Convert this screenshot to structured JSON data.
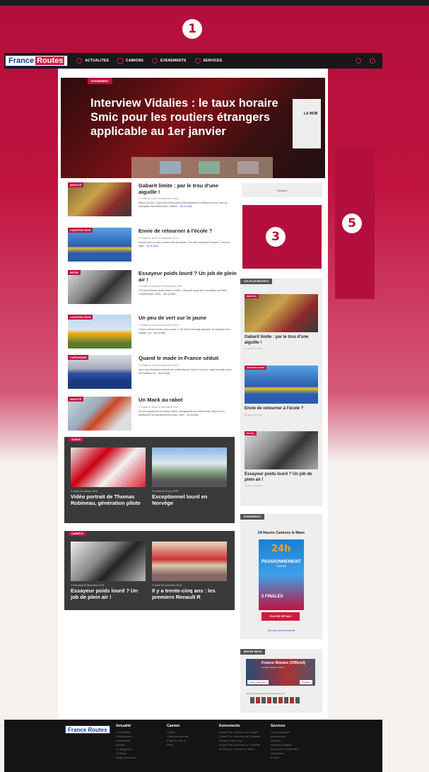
{
  "markers": {
    "m1": "1",
    "m3": "3",
    "m5": "5"
  },
  "nav": {
    "logo_a": "France",
    "logo_b": "Routes",
    "items": [
      "ACTUALITES",
      "CAMIONS",
      "EVENEMENTS",
      "SERVICES"
    ]
  },
  "hero": {
    "tag": "EVENEMENT",
    "title": "Interview Vidalies : le taux horaire Smic pour les routiers étrangers applicable au 1er janvier",
    "side_text": "LA MOB"
  },
  "articles": [
    {
      "tag": "INSOLITE",
      "title": "Gabarit limite : par le trou d'une aiguille !",
      "date": "© Publié le Lundi 14 décembre 2015",
      "excerpt": "Mieux (ou pire ?) que les convois péruviens présentés en début de mois, voici un incroyable franchissement. L'affaire...",
      "more": "lire la suite"
    },
    {
      "tag": "CONSTRUCTEUR",
      "title": "Envie de retourner à l'école ?",
      "date": "© Publié le Jeudi 10 décembre 2015",
      "excerpt": "Avouez qu'il y a pire comme salle de classe. Ces deux superbes Renault T, dont un High...",
      "more": "lire la suite"
    },
    {
      "tag": "RETRO",
      "title": "Essayeur poids lourd ? Un job de plein air !",
      "date": "© Publié le Mercredi 09 décembre 2015",
      "excerpt": "Si France Routes avait existé en 1935, voilà quel aurait été le quotidien de Poids Commerciale. Enfin,...",
      "more": "lire la suite"
    },
    {
      "tag": "CONSTRUCTEUR",
      "title": "Un peu de vert sur le jaune",
      "date": "© Publié le Mardi 08 décembre 2015",
      "excerpt": "« Nous créons un futur plus propre ». Tel est le message appossé, en français et en anglais, sur...",
      "more": "lire la suite"
    },
    {
      "tag": "CARROSSIER",
      "title": "Quand le made in France séduit",
      "date": "© Publié le Lundi 07 décembre 2015",
      "excerpt": "Alors que Solutrans a fermé ses portes depuis moins d'un mois, ayant accueilli parmi ses visiteurs de...",
      "more": "lire la suite"
    },
    {
      "tag": "INSOLITE",
      "title": "Un Mack au rabot",
      "date": "© Publié le Jeudi 03 décembre 2015",
      "excerpt": "Un brin paradoxal ce wrecker Mack, photographié aux Etats-Unis. Pays où l'on affectionne les empattements longs, voire...",
      "more": "lire la suite"
    }
  ],
  "videos": {
    "tag": "VIDEOS",
    "items": [
      {
        "date": "© Jeudi 15 octobre 2015",
        "title": "Vidéo portrait de Thomas Robineau, génération pilote"
      },
      {
        "date": "© Vendredi 19 juin 2015",
        "title": "Exceptionnel lourd en Norvège"
      }
    ]
  },
  "carnet": {
    "tag": "CARNETS",
    "items": [
      {
        "date": "© Mercredi 09 décembre 2015",
        "title": "Essayeur poids lourd ? Un job de plein air !"
      },
      {
        "date": "© Jeudi 26 novembre 2015",
        "title": "Il y a trente-cinq ans : les premiers Renault R"
      }
    ]
  },
  "sidebar": {
    "ad_label": "Publicité",
    "recent_header": "LES PLUS RECENTS",
    "recent": [
      {
        "tag": "INSOLITE",
        "title": "Gabarit limite : par le trou d'une aiguille !",
        "date": "14 décembre 2015"
      },
      {
        "tag": "CONSTRUCTEUR",
        "title": "Envie de retourner à l'école ?",
        "date": "10 décembre 2015"
      },
      {
        "tag": "RETRO",
        "title": "Essayeur poids lourd ? Un job de plein air !",
        "date": "09 décembre 2015"
      }
    ],
    "events_header": "EVENEMENTS",
    "event_title": "24 Heures Camions le Mans",
    "poster_big": "24h",
    "poster_title": "PASSIONNEMENT",
    "poster_sub": "CAMION",
    "poster_finals": "2 FINALES",
    "event_button": "PLUS DE DÉTAILS",
    "event_link": "Voir tous les événements",
    "social_header": "RESTEZ INFOS",
    "fb_name": "France Routes (Officiel)",
    "fb_sub": "12 200 mentions J'aime",
    "fb_like": "J'aime cette Page",
    "fb_share": "Partager",
    "fb_text": "Soyez le premier de vos amis à aimer ça"
  },
  "footer": {
    "logo": "France Routes",
    "columns": [
      {
        "heading": "Actualité",
        "items": [
          "Compétition",
          "Constructeur",
          "Evènement",
          "Insolite",
          "Le Magazine",
          "Politique",
          "Réglementation"
        ]
      },
      {
        "heading": "Camion",
        "items": [
          "Vidéos",
          "Camions décorés",
          "Poids en repos",
          "Rétro"
        ]
      },
      {
        "heading": "Evènements",
        "items": [
          "Grand Prix Camions de Nogaro",
          "Grand Prix Camions de Charade",
          "Europa Truck Trial",
          "Grand Prix Camions de Charade",
          "24 Heures Camions le Mans"
        ]
      },
      {
        "heading": "Services",
        "items": [
          "Liens pratiques",
          "Annonceurs",
          "Contact",
          "Mentions légales",
          "Annonces Ponctuelles",
          "Législation",
          "Emploi"
        ]
      }
    ]
  }
}
